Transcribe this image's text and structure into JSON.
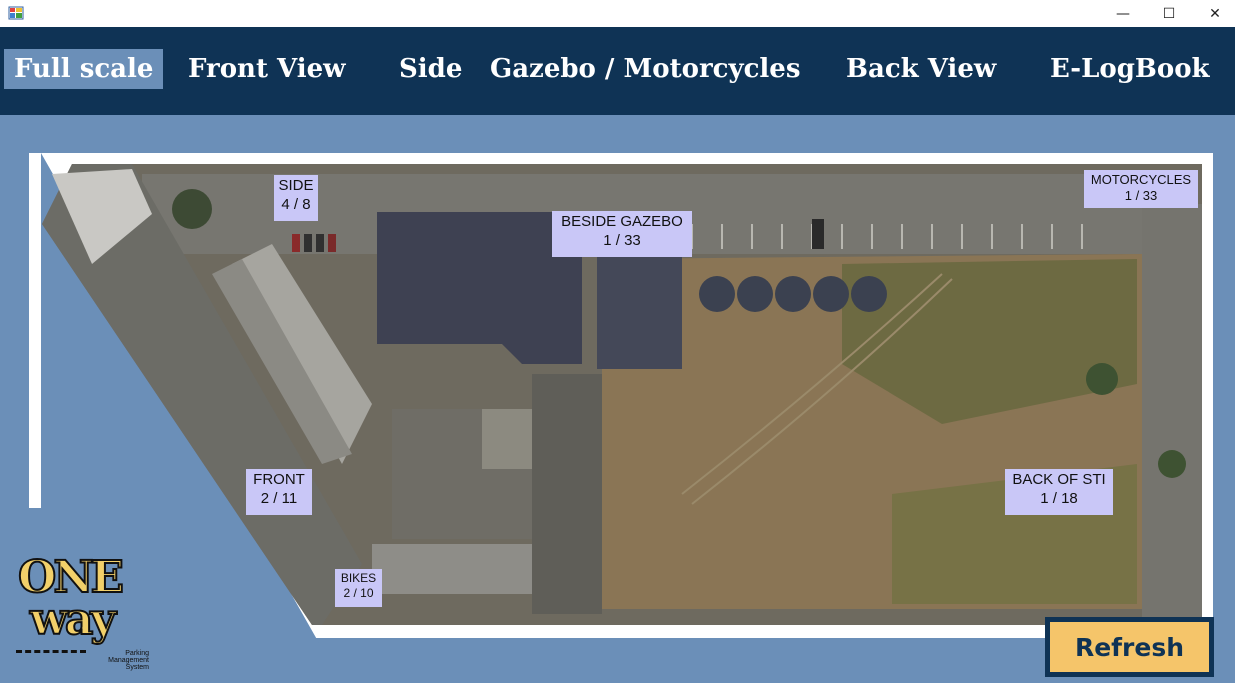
{
  "window": {
    "minimize_glyph": "—",
    "maximize_glyph": "☐",
    "close_glyph": "✕",
    "icon": "app-icon"
  },
  "nav": {
    "items": [
      {
        "label": "Full scale",
        "active": true
      },
      {
        "label": "Front View",
        "active": false
      },
      {
        "label": "Side",
        "active": false
      },
      {
        "label": "Gazebo / Motorcycles",
        "active": false
      },
      {
        "label": "Back View",
        "active": false
      },
      {
        "label": "E-LogBook",
        "active": false
      }
    ]
  },
  "zones": {
    "side": {
      "name": "SIDE",
      "count": "4 / 8"
    },
    "gazebo": {
      "name": "BESIDE GAZEBO",
      "count": "1 / 33"
    },
    "motorcycles": {
      "name": "MOTORCYCLES",
      "count": "1 / 33"
    },
    "front": {
      "name": "FRONT",
      "count": "2 / 11"
    },
    "bikes": {
      "name": "BIKES",
      "count": "2 / 10"
    },
    "back": {
      "name": "BACK OF STI",
      "count": "1 / 18"
    }
  },
  "logo": {
    "line1": "ONE",
    "line2": "way",
    "tagline_1": "Parking",
    "tagline_2": "Management System"
  },
  "refresh_label": "Refresh",
  "colors": {
    "nav_bg": "#0f3355",
    "page_bg": "#6b8fb8",
    "zone_label_bg": "#c9c7f7",
    "refresh_bg": "#f5c56a"
  }
}
